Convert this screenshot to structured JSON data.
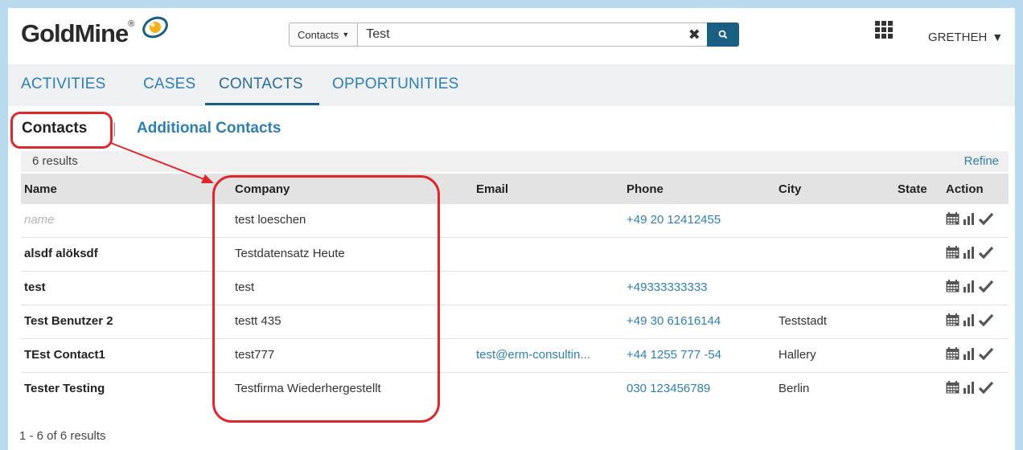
{
  "header": {
    "logo_text": "GoldMine",
    "logo_registered": "®",
    "search": {
      "scope_label": "Contacts",
      "query": "Test",
      "clear_icon": "close-icon",
      "search_icon": "search-icon"
    },
    "apps_icon": "grid-icon",
    "user_name": "GRETHEH"
  },
  "nav": {
    "tabs": [
      {
        "label": "ACTIVITIES"
      },
      {
        "label": "CASES"
      },
      {
        "label": "CONTACTS",
        "active": true
      },
      {
        "label": "OPPORTUNITIES"
      }
    ]
  },
  "subtabs": {
    "contacts": "Contacts",
    "separator": "|",
    "additional": "Additional Contacts"
  },
  "results": {
    "count_text": "6 results",
    "refine_label": "Refine",
    "footer_text": "1 - 6 of 6 results"
  },
  "table": {
    "headers": {
      "name": "Name",
      "company": "Company",
      "email": "Email",
      "phone": "Phone",
      "city": "City",
      "state": "State",
      "action": "Action"
    },
    "rows": [
      {
        "name": "name",
        "company": "test loeschen",
        "email": "",
        "phone": "+49 20 12412455",
        "city": ""
      },
      {
        "name": "alsdf alöksdf",
        "company": "Testdatensatz Heute",
        "email": "",
        "phone": "",
        "city": ""
      },
      {
        "name": "test",
        "company": "test",
        "email": "",
        "phone": "+49333333333",
        "city": ""
      },
      {
        "name": "Test Benutzer 2",
        "company": "testt 435",
        "email": "",
        "phone": "+49 30 61616144",
        "city": "Teststadt"
      },
      {
        "name": "TEst Contact1",
        "company": "test777",
        "email": "test@erm-consultin...",
        "phone": "+44 1255 777 -54",
        "city": "Hallery"
      },
      {
        "name": "Tester Testing",
        "company": "Testfirma Wiederhergestellt",
        "email": "",
        "phone": "030 123456789",
        "city": "Berlin"
      }
    ],
    "action_icons": [
      "calendar-icon",
      "bar-chart-icon",
      "checkmark-icon"
    ]
  },
  "colors": {
    "link": "#2f7fb3",
    "brand_dark": "#1a5f82",
    "annotation": "#e0262d",
    "page_border": "#b9d9ee"
  }
}
